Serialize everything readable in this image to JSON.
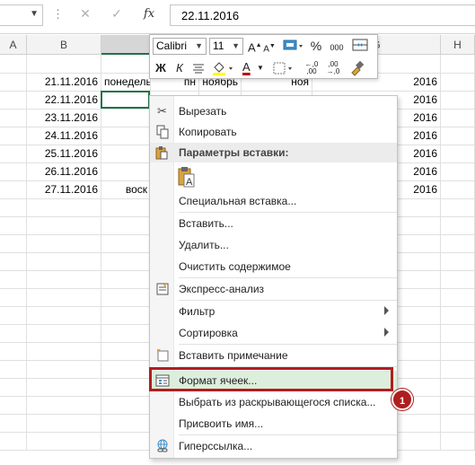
{
  "formula_bar": {
    "namebox_value": "",
    "fx_label": "fx",
    "cancel_glyph": "✕",
    "enter_glyph": "✓",
    "formula_value": "22.11.2016"
  },
  "columns": [
    {
      "label": "A"
    },
    {
      "label": "B"
    },
    {
      "label": ""
    },
    {
      "label": ""
    },
    {
      "label": ""
    },
    {
      "label": ""
    },
    {
      "label": "G"
    },
    {
      "label": "H"
    }
  ],
  "rows": [
    {
      "b": "",
      "c": "",
      "d": "",
      "e": "",
      "f": "",
      "g": ""
    },
    {
      "b": "21.11.2016",
      "c": "понедельник",
      "d": "пн",
      "e": "ноябрь",
      "f": "ноя",
      "g": "2016"
    },
    {
      "b": "22.11.2016",
      "c": "",
      "d": "",
      "e": "",
      "f": "",
      "g": "2016"
    },
    {
      "b": "23.11.2016",
      "c": "",
      "d": "",
      "e": "",
      "f": "",
      "g": "2016"
    },
    {
      "b": "24.11.2016",
      "c": "",
      "d": "",
      "e": "",
      "f": "",
      "g": "2016"
    },
    {
      "b": "25.11.2016",
      "c": "",
      "d": "",
      "e": "",
      "f": "",
      "g": "2016"
    },
    {
      "b": "26.11.2016",
      "c": "",
      "d": "",
      "e": "",
      "f": "",
      "g": "2016"
    },
    {
      "b": "27.11.2016",
      "c": "воск",
      "d": "",
      "e": "",
      "f": "",
      "g": "2016"
    },
    {
      "b": "",
      "c": "",
      "d": "",
      "e": "",
      "f": "",
      "g": ""
    },
    {
      "b": "",
      "c": "",
      "d": "",
      "e": "",
      "f": "",
      "g": ""
    },
    {
      "b": "",
      "c": "",
      "d": "",
      "e": "",
      "f": "",
      "g": ""
    },
    {
      "b": "",
      "c": "",
      "d": "",
      "e": "",
      "f": "",
      "g": ""
    },
    {
      "b": "",
      "c": "",
      "d": "",
      "e": "",
      "f": "",
      "g": ""
    },
    {
      "b": "",
      "c": "",
      "d": "",
      "e": "",
      "f": "",
      "g": ""
    },
    {
      "b": "",
      "c": "",
      "d": "",
      "e": "",
      "f": "",
      "g": ""
    },
    {
      "b": "",
      "c": "",
      "d": "",
      "e": "",
      "f": "",
      "g": ""
    },
    {
      "b": "",
      "c": "",
      "d": "",
      "e": "",
      "f": "",
      "g": ""
    },
    {
      "b": "",
      "c": "",
      "d": "",
      "e": "",
      "f": "",
      "g": ""
    },
    {
      "b": "",
      "c": "",
      "d": "",
      "e": "",
      "f": "",
      "g": ""
    },
    {
      "b": "",
      "c": "",
      "d": "",
      "e": "",
      "f": "",
      "g": ""
    },
    {
      "b": "",
      "c": "",
      "d": "",
      "e": "",
      "f": "",
      "g": ""
    },
    {
      "b": "",
      "c": "",
      "d": "",
      "e": "",
      "f": "",
      "g": ""
    }
  ],
  "mini_toolbar": {
    "font_name": "Calibri",
    "font_size": "11",
    "grow_font": "A",
    "shrink_font": "A",
    "percent": "%",
    "thousands": "000",
    "bold": "Ж",
    "italic": "К",
    "font_color_letter": "А",
    "increase_decimal": "←,0 ,00",
    "decrease_decimal": ",00 →,0",
    "font_color": "#c00000",
    "fill_color": "#ffff00"
  },
  "context_menu": {
    "cut": "Вырезать",
    "copy": "Копировать",
    "paste_options": "Параметры вставки:",
    "paste_special": "Специальная вставка...",
    "insert": "Вставить...",
    "delete": "Удалить...",
    "clear_contents": "Очистить содержимое",
    "quick_analysis": "Экспресс-анализ",
    "filter": "Фильтр",
    "sort": "Сортировка",
    "insert_comment": "Вставить примечание",
    "format_cells": "Формат ячеек...",
    "pick_from_list": "Выбрать из раскрывающегося списка...",
    "define_name": "Присвоить имя...",
    "hyperlink": "Гиперссылка..."
  },
  "annotation": {
    "step_number": "1",
    "highlight_color": "#b01e1e"
  },
  "colors": {
    "excel_green": "#217346",
    "selected_item_bg": "#dcefdc"
  }
}
